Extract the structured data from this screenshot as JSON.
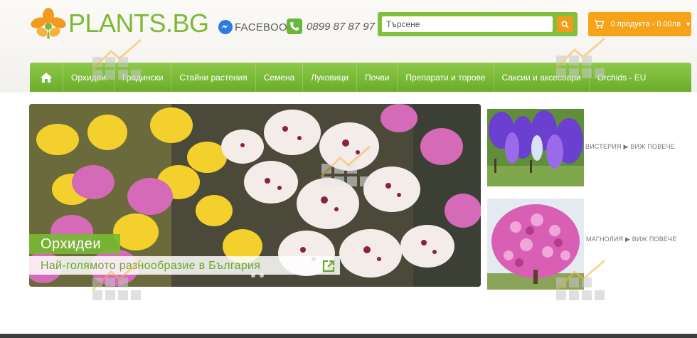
{
  "brand": {
    "name": "PLANTS.BG"
  },
  "header": {
    "facebook_label": "FACEBOOK",
    "phone": "0899 87 87 97",
    "search_placeholder": "Търсене",
    "cart_label": "0 продукта - 0.00лв"
  },
  "nav": {
    "items": [
      {
        "label": "Орхидеи"
      },
      {
        "label": "Градински"
      },
      {
        "label": "Стайни растения"
      },
      {
        "label": "Семена"
      },
      {
        "label": "Луковици"
      },
      {
        "label": "Почви"
      },
      {
        "label": "Препарати и торове"
      },
      {
        "label": "Саксии и аксесоари"
      },
      {
        "label": "Orchids - EU"
      }
    ]
  },
  "hero": {
    "title": "Орхидеи",
    "subtitle": "Най-голямото разнообразие в България"
  },
  "side_cards": [
    {
      "label": "ВИСТЕРИЯ ▶ ВИЖ ПОВЕЧЕ"
    },
    {
      "label": "МАГНОЛИЯ ▶ ВИЖ ПОВЕЧЕ"
    }
  ],
  "colors": {
    "brand_green": "#7cb936",
    "nav_green": "#7bbd3a",
    "accent_orange": "#f5a319"
  }
}
